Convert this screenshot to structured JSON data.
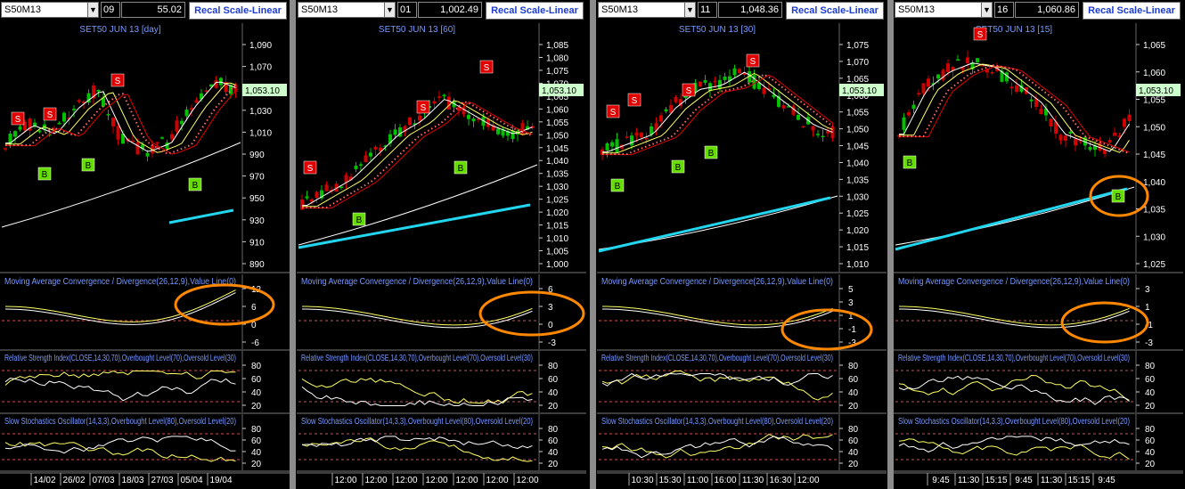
{
  "colors": {
    "bg": "#000000",
    "up": "#00c000",
    "down": "#d00000",
    "fast": "#ffffff",
    "mid": "#ffff66",
    "slow": "#e00000",
    "longma": "#ffffff",
    "ma200": "#22d6f0",
    "dots": "#ff6a6a",
    "signalS": "#e00000",
    "signalB": "#66dd00",
    "title": "#7799ff",
    "tick": "#ffffff",
    "priceTag": "#ccffcc",
    "highlight": "#ff8800"
  },
  "panels": [
    {
      "symbol": "S50M13",
      "index": "09",
      "price": "55.02",
      "recal": "Recal Scale-Linear",
      "chart_data": {
        "type": "candlestick",
        "title": "SET50 JUN 13  [day]",
        "yticks": [
          "1,090",
          "1,070",
          "1,050",
          "1,030",
          "1,010",
          "990",
          "970",
          "950",
          "930",
          "910",
          "890"
        ],
        "last": "1,053.10",
        "xticks": [
          "14/02",
          "26/02",
          "07/03",
          "18/03",
          "27/03",
          "05/04",
          "19/04"
        ]
      },
      "ind": {
        "macd_title": "Moving Average Convergence / Divergence(26,12,9),Value Line(0)",
        "macd_ticks": [
          "12",
          "6",
          "0",
          "-6"
        ],
        "rsi_title": "Relative Strength Index(CLOSE,14,30,70),Overbought Level(70),Oversold Level(30)",
        "rsi_ticks": [
          "80",
          "60",
          "40",
          "20"
        ],
        "sto_title": "Slow Stochastics Oscillator(14,3,3),Overbought Level(80),Oversold Level(20)",
        "sto_ticks": [
          "80",
          "60",
          "40",
          "20"
        ]
      },
      "signals": {
        "s": "S",
        "b": "B"
      }
    },
    {
      "symbol": "S50M13",
      "index": "01",
      "price": "1,002.49",
      "recal": "Recal Scale-Linear",
      "chart_data": {
        "type": "candlestick",
        "title": "SET50 JUN 13  [60]",
        "yticks": [
          "1,085",
          "1,080",
          "1,075",
          "1,070",
          "1,065",
          "1,060",
          "1,055",
          "1,050",
          "1,045",
          "1,040",
          "1,035",
          "1,030",
          "1,025",
          "1,020",
          "1,015",
          "1,010",
          "1,005",
          "1,000"
        ],
        "last": "1,053.10",
        "xticks": [
          "12:00",
          "12:00",
          "12:00",
          "12:00",
          "12:00",
          "12:00",
          "12:00"
        ]
      },
      "ind": {
        "macd_title": "Moving Average Convergence / Divergence(26,12,9),Value Line(0)",
        "macd_ticks": [
          "6",
          "3",
          "0",
          "-3"
        ],
        "rsi_title": "Relative Strength Index(CLOSE,14,30,70),Overbought Level(70),Oversold Level(30)",
        "rsi_ticks": [
          "80",
          "60",
          "40",
          "20"
        ],
        "sto_title": "Slow Stochastics Oscillator(14,3,3),Overbought Level(80),Oversold Level(20)",
        "sto_ticks": [
          "80",
          "60",
          "40",
          "20"
        ]
      },
      "signals": {
        "s": "S",
        "b": "B"
      }
    },
    {
      "symbol": "S50M13",
      "index": "11",
      "price": "1,048.36",
      "recal": "Recal Scale-Linear",
      "chart_data": {
        "type": "candlestick",
        "title": "SET50 JUN 13  [30]",
        "yticks": [
          "1,075",
          "1,070",
          "1,065",
          "1,060",
          "1,055",
          "1,050",
          "1,045",
          "1,040",
          "1,035",
          "1,030",
          "1,025",
          "1,020",
          "1,015",
          "1,010"
        ],
        "last": "1,053.10",
        "xticks": [
          "10:30",
          "15:30",
          "11:00",
          "16:00",
          "11:30",
          "16:30",
          "12:00"
        ]
      },
      "ind": {
        "macd_title": "Moving Average Convergence / Divergence(26,12,9),Value Line(0)",
        "macd_ticks": [
          "5",
          "3",
          "1",
          "-1",
          "-3"
        ],
        "rsi_title": "Relative Strength Index(CLOSE,14,30,70),Overbought Level(70),Oversold Level(30)",
        "rsi_ticks": [
          "80",
          "60",
          "40",
          "20"
        ],
        "sto_title": "Slow Stochastics Oscillator(14,3,3),Overbought Level(80),Oversold Level(20)",
        "sto_ticks": [
          "80",
          "60",
          "40",
          "20"
        ]
      },
      "signals": {
        "s": "S",
        "b": "B"
      }
    },
    {
      "symbol": "S50M13",
      "index": "16",
      "price": "1,060.86",
      "recal": "Recal Scale-Linear",
      "chart_data": {
        "type": "candlestick",
        "title": "SET50 JUN 13  [15]",
        "yticks": [
          "1,065",
          "1,060",
          "1,055",
          "1,050",
          "1,045",
          "1,040",
          "1,035",
          "1,030",
          "1,025"
        ],
        "last": "1,053.10",
        "xticks": [
          "9:45",
          "11:30",
          "15:15",
          "9:45",
          "11:30",
          "15:15",
          "9:45"
        ]
      },
      "ind": {
        "macd_title": "Moving Average Convergence / Divergence(26,12,9),Value Line(0)",
        "macd_ticks": [
          "3",
          "1",
          "-1",
          "-3"
        ],
        "rsi_title": "Relative Strength Index(CLOSE,14,30,70),Overbought Level(70),Oversold Level(30)",
        "rsi_ticks": [
          "80",
          "60",
          "40",
          "20"
        ],
        "sto_title": "Slow Stochastics Oscillator(14,3,3),Overbought Level(80),Oversold Level(20)",
        "sto_ticks": [
          "80",
          "60",
          "40",
          "20"
        ]
      },
      "signals": {
        "s": "S",
        "b": "B"
      }
    }
  ]
}
